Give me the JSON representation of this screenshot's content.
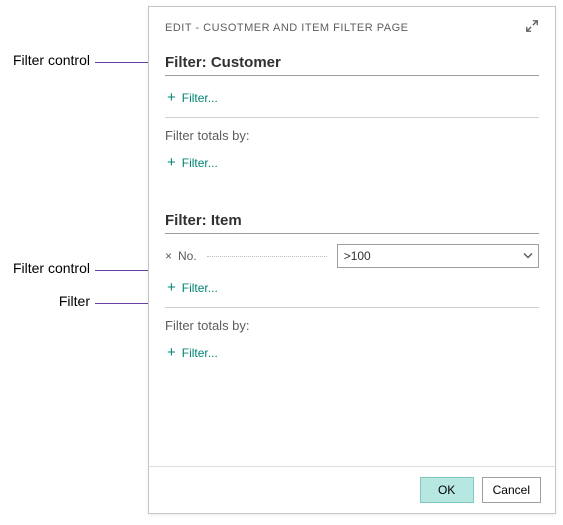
{
  "annotations": {
    "filter_control_1": "Filter control",
    "filter_control_2": "Filter control",
    "filter": "Filter"
  },
  "dialog": {
    "title": "EDIT - CUSOTMER AND ITEM FILTER PAGE",
    "sections": {
      "customer": {
        "heading": "Filter: Customer",
        "add_filter": "Filter...",
        "totals_label": "Filter totals by:",
        "add_totals_filter": "Filter..."
      },
      "item": {
        "heading": "Filter: Item",
        "row": {
          "field": "No.",
          "value": ">100"
        },
        "add_filter": "Filter...",
        "totals_label": "Filter totals by:",
        "add_totals_filter": "Filter..."
      }
    },
    "footer": {
      "ok": "OK",
      "cancel": "Cancel"
    }
  }
}
